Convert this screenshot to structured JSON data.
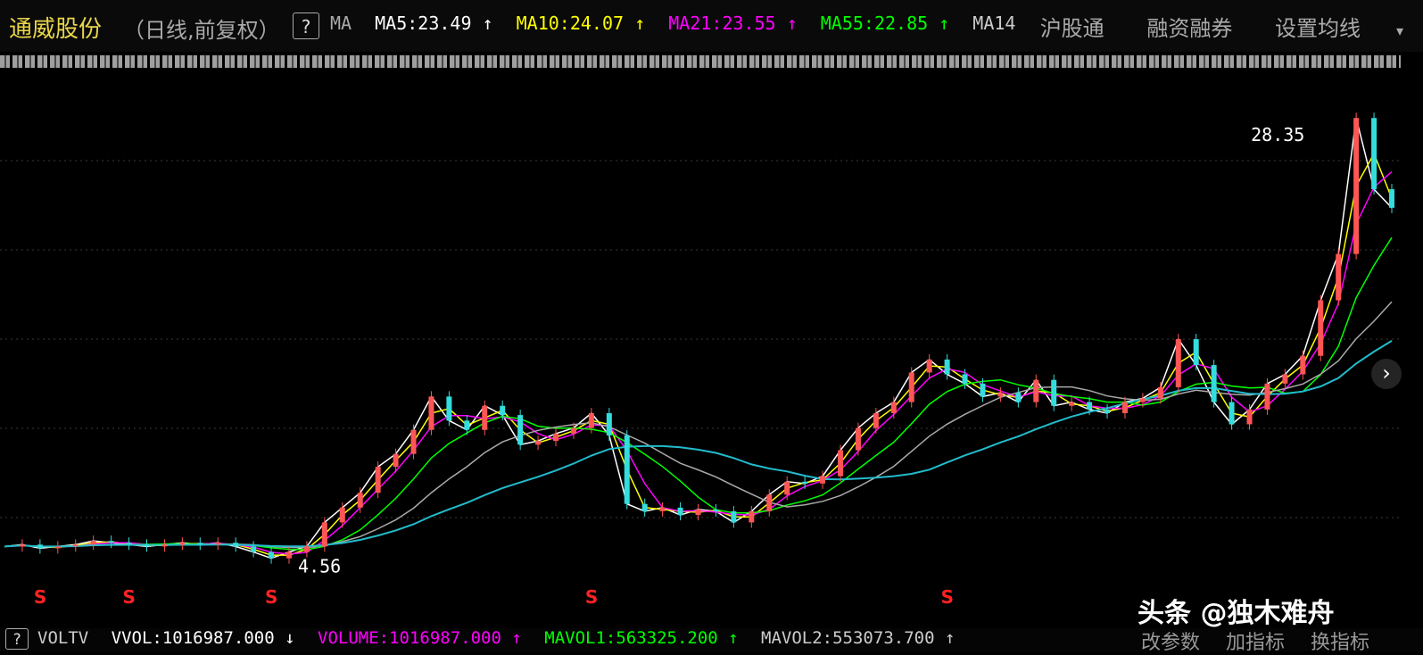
{
  "header": {
    "stock_name": "通威股份",
    "period": "（日线,前复权）",
    "help": "?",
    "ma_label": "MA",
    "ma_values": [
      {
        "text": "MA5:23.49 ↑",
        "color": "#ffffff"
      },
      {
        "text": "MA10:24.07 ↑",
        "color": "#ffff00"
      },
      {
        "text": "MA21:23.55 ↑",
        "color": "#ff00ff"
      },
      {
        "text": "MA55:22.85 ↑",
        "color": "#00ff00"
      },
      {
        "text": "MA14",
        "color": "#cccccc"
      }
    ],
    "right_links": [
      "沪股通",
      "融资融券",
      "设置均线"
    ],
    "dropdown_caret": "▾"
  },
  "chart_data": {
    "type": "line",
    "title": "",
    "annotations": [
      {
        "text": "28.35",
        "label": "high"
      },
      {
        "text": "4.56",
        "label": "low"
      }
    ],
    "signal_marker": "S",
    "signal_count": 5,
    "grid": true,
    "series": [
      {
        "name": "MA5",
        "color": "#ffffff"
      },
      {
        "name": "MA10",
        "color": "#ffff00"
      },
      {
        "name": "MA21",
        "color": "#ff00ff"
      },
      {
        "name": "MA55",
        "color": "#00ff00"
      },
      {
        "name": "MA14",
        "color": "#aaaaaa"
      },
      {
        "color": "#22bbcc"
      }
    ],
    "x": [
      0,
      20,
      40,
      60,
      80,
      100,
      120,
      140,
      160,
      180,
      200,
      220,
      240,
      260,
      280,
      300,
      320,
      340,
      360,
      380,
      400,
      420,
      440,
      460,
      480,
      500,
      520,
      540,
      560,
      580,
      600,
      620,
      640,
      660,
      680,
      700,
      720,
      740,
      760,
      780,
      800,
      820,
      840,
      860,
      880,
      900,
      920,
      940,
      960,
      980,
      1000,
      1020,
      1040,
      1060,
      1080,
      1100,
      1120,
      1140,
      1160,
      1180,
      1200,
      1220,
      1240,
      1260,
      1280,
      1300,
      1320,
      1340,
      1360,
      1380,
      1400,
      1420,
      1440,
      1460,
      1480,
      1500,
      1520,
      1540,
      1560
    ],
    "price": [
      5.2,
      5.3,
      5.1,
      5.2,
      5.3,
      5.5,
      5.4,
      5.3,
      5.2,
      5.3,
      5.4,
      5.3,
      5.4,
      5.2,
      4.9,
      4.56,
      4.9,
      5.2,
      6.5,
      7.3,
      8.1,
      9.5,
      10.2,
      11.5,
      13.3,
      12.0,
      11.5,
      12.8,
      12.3,
      10.7,
      10.9,
      11.3,
      11.6,
      12.4,
      11.2,
      7.5,
      7.1,
      7.3,
      6.9,
      7.2,
      7.1,
      6.5,
      7.1,
      8.0,
      8.7,
      8.6,
      9.0,
      10.4,
      11.6,
      12.4,
      13.0,
      14.6,
      15.3,
      14.5,
      14.0,
      13.3,
      13.5,
      13.0,
      14.2,
      12.8,
      13.0,
      12.6,
      12.4,
      13.0,
      13.2,
      13.8,
      16.4,
      15.0,
      13.0,
      11.8,
      12.6,
      14.0,
      14.5,
      15.5,
      18.5,
      21.0,
      28.35,
      24.5,
      23.5
    ],
    "ylim": [
      3,
      30
    ]
  },
  "volume_bar": {
    "help": "?",
    "items": [
      {
        "text": "VOLTV",
        "color": "#cccccc"
      },
      {
        "text": "VVOL:1016987.000 ↓",
        "color": "#ffffff"
      },
      {
        "text": "VOLUME:1016987.000 ↑",
        "color": "#ff00ff"
      },
      {
        "text": "MAVOL1:563325.200 ↑",
        "color": "#00ff00"
      },
      {
        "text": "MAVOL2:553073.700 ↑",
        "color": "#cccccc"
      }
    ],
    "right_links": [
      "改参数",
      "加指标",
      "换指标"
    ]
  },
  "watermark": "头条 @独木难舟",
  "next_arrow": "›"
}
